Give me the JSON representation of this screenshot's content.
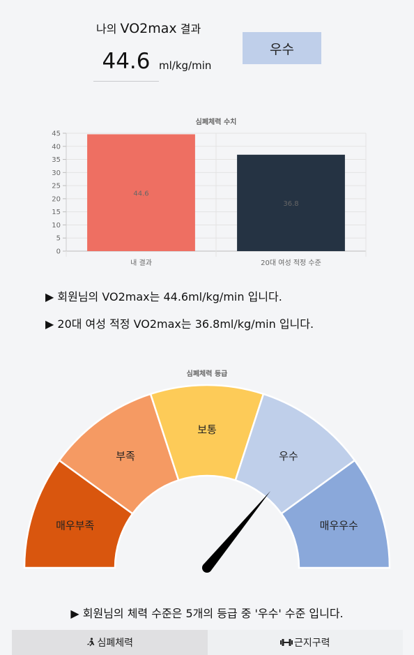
{
  "header": {
    "title_prefix": "나의",
    "title_bold": "VO2max",
    "title_suffix": "결과",
    "value": "44.6",
    "unit": "ml/kg/min",
    "grade": "우수"
  },
  "chart_data": [
    {
      "type": "bar",
      "title": "심폐체력 수치",
      "categories": [
        "내 결과",
        "20대 여성 적정 수준"
      ],
      "values": [
        44.6,
        36.8
      ],
      "value_labels": [
        "44.6",
        "36.8"
      ],
      "colors": [
        "#ee6f62",
        "#253343"
      ],
      "ylim": [
        0,
        45
      ],
      "yticks": [
        "0",
        "5",
        "10",
        "15",
        "20",
        "25",
        "30",
        "35",
        "40",
        "45"
      ],
      "grid": true,
      "legend": "none"
    },
    {
      "type": "gauge",
      "title": "심폐체력 등급",
      "categories": [
        "매우부족",
        "부족",
        "보통",
        "우수",
        "매우우수"
      ],
      "colors": [
        "#d9560e",
        "#f59a63",
        "#fdcb58",
        "#bfcfea",
        "#8aa8da"
      ],
      "needle_value": 3.6
    }
  ],
  "info": {
    "line1": "▶ 회원님의 VO2max는 44.6ml/kg/min 입니다.",
    "line2": "▶ 20대 여성 적정 VO2max는 36.8ml/kg/min 입니다."
  },
  "summary": "▶ 회원님의 체력 수준은 5개의 등급 중 '우수' 수준 입니다.",
  "tabs": [
    {
      "label": "심폐체력",
      "icon": "running-icon",
      "active": true
    },
    {
      "label": "근지구력",
      "icon": "dumbbell-icon",
      "active": false
    }
  ]
}
